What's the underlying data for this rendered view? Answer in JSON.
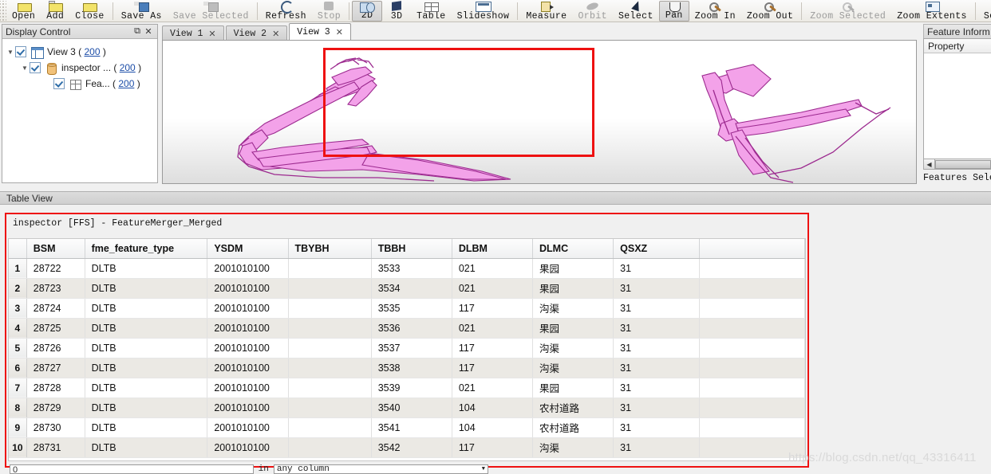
{
  "toolbar": {
    "items": [
      {
        "label": "Open",
        "icon": "open-folder-icon",
        "enabled": true,
        "active": false
      },
      {
        "label": "Add",
        "icon": "add-folder-icon",
        "enabled": true,
        "active": false
      },
      {
        "label": "Close",
        "icon": "close-folder-icon",
        "enabled": true,
        "active": false
      },
      {
        "label": "Save As",
        "icon": "save-as-icon",
        "enabled": true,
        "active": false
      },
      {
        "label": "Save Selected",
        "icon": "save-selected-icon",
        "enabled": false,
        "active": false
      },
      {
        "label": "Refresh",
        "icon": "refresh-icon",
        "enabled": true,
        "active": false
      },
      {
        "label": "Stop",
        "icon": "stop-icon",
        "enabled": false,
        "active": false
      },
      {
        "label": "2D",
        "icon": "view-2d-icon",
        "enabled": true,
        "active": true
      },
      {
        "label": "3D",
        "icon": "view-3d-icon",
        "enabled": true,
        "active": false
      },
      {
        "label": "Table",
        "icon": "table-icon",
        "enabled": true,
        "active": false
      },
      {
        "label": "Slideshow",
        "icon": "slideshow-icon",
        "enabled": true,
        "active": false
      },
      {
        "label": "Measure",
        "icon": "measure-icon",
        "enabled": true,
        "active": false
      },
      {
        "label": "Orbit",
        "icon": "orbit-icon",
        "enabled": false,
        "active": false
      },
      {
        "label": "Select",
        "icon": "select-arrow-icon",
        "enabled": true,
        "active": false
      },
      {
        "label": "Pan",
        "icon": "pan-hand-icon",
        "enabled": true,
        "active": true
      },
      {
        "label": "Zoom In",
        "icon": "zoom-in-icon",
        "enabled": true,
        "active": false
      },
      {
        "label": "Zoom Out",
        "icon": "zoom-out-icon",
        "enabled": true,
        "active": false
      },
      {
        "label": "Zoom Selected",
        "icon": "zoom-selected-icon",
        "enabled": false,
        "active": false
      },
      {
        "label": "Zoom Extents",
        "icon": "zoom-extents-icon",
        "enabled": true,
        "active": false
      },
      {
        "label": "Select No Geome",
        "icon": "select-no-geometry-icon",
        "enabled": true,
        "active": false
      }
    ]
  },
  "display_control": {
    "title": "Display Control",
    "restore_icon": "restore-window-icon",
    "close_icon": "close-icon",
    "tree": [
      {
        "label": "View 3",
        "count": "200",
        "icon": "view-icon",
        "checked": true,
        "expanded": true,
        "depth": 0
      },
      {
        "label": "inspector ...",
        "count": "200",
        "icon": "database-icon",
        "checked": true,
        "expanded": true,
        "depth": 1
      },
      {
        "label": "Fea...",
        "count": "200",
        "icon": "feature-type-icon",
        "checked": true,
        "expanded": false,
        "depth": 2
      }
    ]
  },
  "view_tabs": [
    {
      "label": "View 1",
      "selected": false,
      "close_icon": "close-icon"
    },
    {
      "label": "View 2",
      "selected": false,
      "close_icon": "close-icon"
    },
    {
      "label": "View 3",
      "selected": true,
      "close_icon": "close-icon"
    }
  ],
  "canvas": {
    "geometry_fill": "#f2a0e8",
    "geometry_stroke": "#9c2a8f",
    "selection_box_color": "#ee1111"
  },
  "feature_information": {
    "title": "Feature Inform",
    "column_header": "Property",
    "status": "Features Selec",
    "scroll_left_icon": "scroll-left-arrow-icon"
  },
  "table_view": {
    "panel_title": "Table View",
    "source_label": "inspector [FFS] - FeatureMerger_Merged",
    "highlight_color": "#ee1111",
    "columns": [
      "",
      "BSM",
      "fme_feature_type",
      "YSDM",
      "TBYBH",
      "TBBH",
      "DLBM",
      "DLMC",
      "QSXZ",
      ""
    ],
    "rows": [
      {
        "n": "1",
        "BSM": "28722",
        "fme_feature_type": "DLTB",
        "YSDM": "2001010100",
        "TBYBH": "",
        "TBBH": "3533",
        "DLBM": "021",
        "DLMC": "果园",
        "QSXZ": "31",
        "extra": ""
      },
      {
        "n": "2",
        "BSM": "28723",
        "fme_feature_type": "DLTB",
        "YSDM": "2001010100",
        "TBYBH": "",
        "TBBH": "3534",
        "DLBM": "021",
        "DLMC": "果园",
        "QSXZ": "31",
        "extra": ""
      },
      {
        "n": "3",
        "BSM": "28724",
        "fme_feature_type": "DLTB",
        "YSDM": "2001010100",
        "TBYBH": "",
        "TBBH": "3535",
        "DLBM": "117",
        "DLMC": "沟渠",
        "QSXZ": "31",
        "extra": ""
      },
      {
        "n": "4",
        "BSM": "28725",
        "fme_feature_type": "DLTB",
        "YSDM": "2001010100",
        "TBYBH": "",
        "TBBH": "3536",
        "DLBM": "021",
        "DLMC": "果园",
        "QSXZ": "31",
        "extra": ""
      },
      {
        "n": "5",
        "BSM": "28726",
        "fme_feature_type": "DLTB",
        "YSDM": "2001010100",
        "TBYBH": "",
        "TBBH": "3537",
        "DLBM": "117",
        "DLMC": "沟渠",
        "QSXZ": "31",
        "extra": ""
      },
      {
        "n": "6",
        "BSM": "28727",
        "fme_feature_type": "DLTB",
        "YSDM": "2001010100",
        "TBYBH": "",
        "TBBH": "3538",
        "DLBM": "117",
        "DLMC": "沟渠",
        "QSXZ": "31",
        "extra": ""
      },
      {
        "n": "7",
        "BSM": "28728",
        "fme_feature_type": "DLTB",
        "YSDM": "2001010100",
        "TBYBH": "",
        "TBBH": "3539",
        "DLBM": "021",
        "DLMC": "果园",
        "QSXZ": "31",
        "extra": ""
      },
      {
        "n": "8",
        "BSM": "28729",
        "fme_feature_type": "DLTB",
        "YSDM": "2001010100",
        "TBYBH": "",
        "TBBH": "3540",
        "DLBM": "104",
        "DLMC": "农村道路",
        "QSXZ": "31",
        "extra": ""
      },
      {
        "n": "9",
        "BSM": "28730",
        "fme_feature_type": "DLTB",
        "YSDM": "2001010100",
        "TBYBH": "",
        "TBBH": "3541",
        "DLBM": "104",
        "DLMC": "农村道路",
        "QSXZ": "31",
        "extra": ""
      },
      {
        "n": "10",
        "BSM": "28731",
        "fme_feature_type": "DLTB",
        "YSDM": "2001010100",
        "TBYBH": "",
        "TBBH": "3542",
        "DLBM": "117",
        "DLMC": "沟渠",
        "QSXZ": "31",
        "extra": ""
      }
    ]
  },
  "search_bar": {
    "query": "0",
    "in_label": "in",
    "column_selector": "any column",
    "dropdown_icon": "chevron-down-icon"
  },
  "watermark": "https://blog.csdn.net/qq_43316411"
}
